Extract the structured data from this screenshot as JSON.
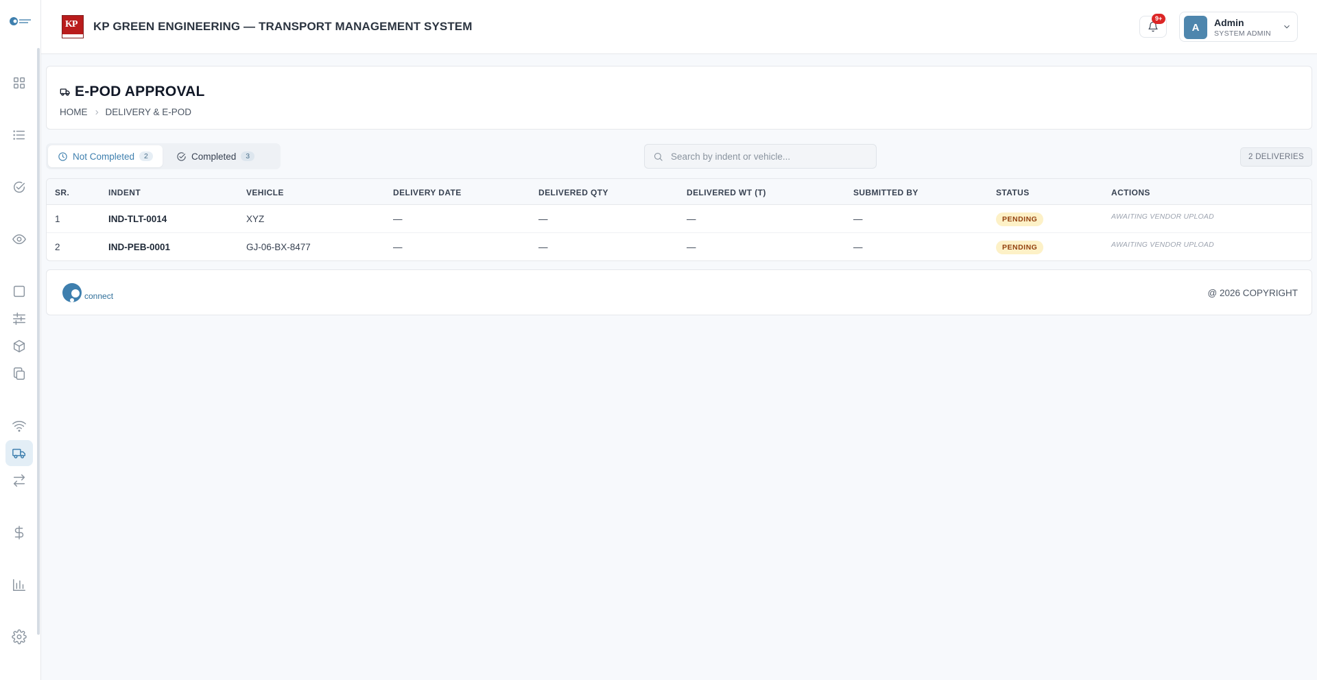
{
  "app": {
    "title": "KP GREEN ENGINEERING — TRANSPORT MANAGEMENT SYSTEM",
    "brand_logo_text": "KP",
    "accent_color": "#3e7fae"
  },
  "sidebar": {
    "items": [
      {
        "icon": "grid-icon"
      },
      {
        "icon": "list-icon"
      },
      {
        "icon": "check-circle-icon"
      },
      {
        "icon": "eye-icon"
      },
      {
        "icon": "square-icon"
      },
      {
        "icon": "sliders-icon"
      },
      {
        "icon": "box-icon"
      },
      {
        "icon": "copy-icon"
      },
      {
        "icon": "wifi-icon"
      },
      {
        "icon": "truck-icon",
        "active": true
      },
      {
        "icon": "transfer-icon"
      },
      {
        "icon": "dollar-icon"
      },
      {
        "icon": "bar-chart-icon"
      },
      {
        "icon": "gear-icon"
      }
    ]
  },
  "header": {
    "notifications_badge": "9+",
    "user": {
      "initial": "A",
      "name": "Admin",
      "role": "SYSTEM ADMIN"
    }
  },
  "page": {
    "title": "E-POD APPROVAL",
    "breadcrumb": [
      "HOME",
      "DELIVERY & E-POD"
    ]
  },
  "tabs": [
    {
      "label": "Not Completed",
      "count": "2",
      "active": true
    },
    {
      "label": "Completed",
      "count": "3",
      "active": false
    }
  ],
  "search": {
    "placeholder": "Search by indent or vehicle...",
    "value": ""
  },
  "deliveries_count": "2 DELIVERIES",
  "table": {
    "columns": [
      "SR.",
      "INDENT",
      "VEHICLE",
      "DELIVERY DATE",
      "DELIVERED QTY",
      "DELIVERED WT (T)",
      "SUBMITTED BY",
      "STATUS",
      "ACTIONS"
    ],
    "rows": [
      {
        "sr": "1",
        "indent": "IND-TLT-0014",
        "vehicle": "XYZ",
        "delivery_date": "—",
        "delivered_qty": "—",
        "delivered_wt": "—",
        "submitted_by": "—",
        "status": "PENDING",
        "action": "AWAITING VENDOR UPLOAD"
      },
      {
        "sr": "2",
        "indent": "IND-PEB-0001",
        "vehicle": "GJ-06-BX-8477",
        "delivery_date": "—",
        "delivered_qty": "—",
        "delivered_wt": "—",
        "submitted_by": "—",
        "status": "PENDING",
        "action": "AWAITING VENDOR UPLOAD"
      }
    ]
  },
  "footer": {
    "logo_text": "connect",
    "copyright": "@ 2026 COPYRIGHT"
  }
}
